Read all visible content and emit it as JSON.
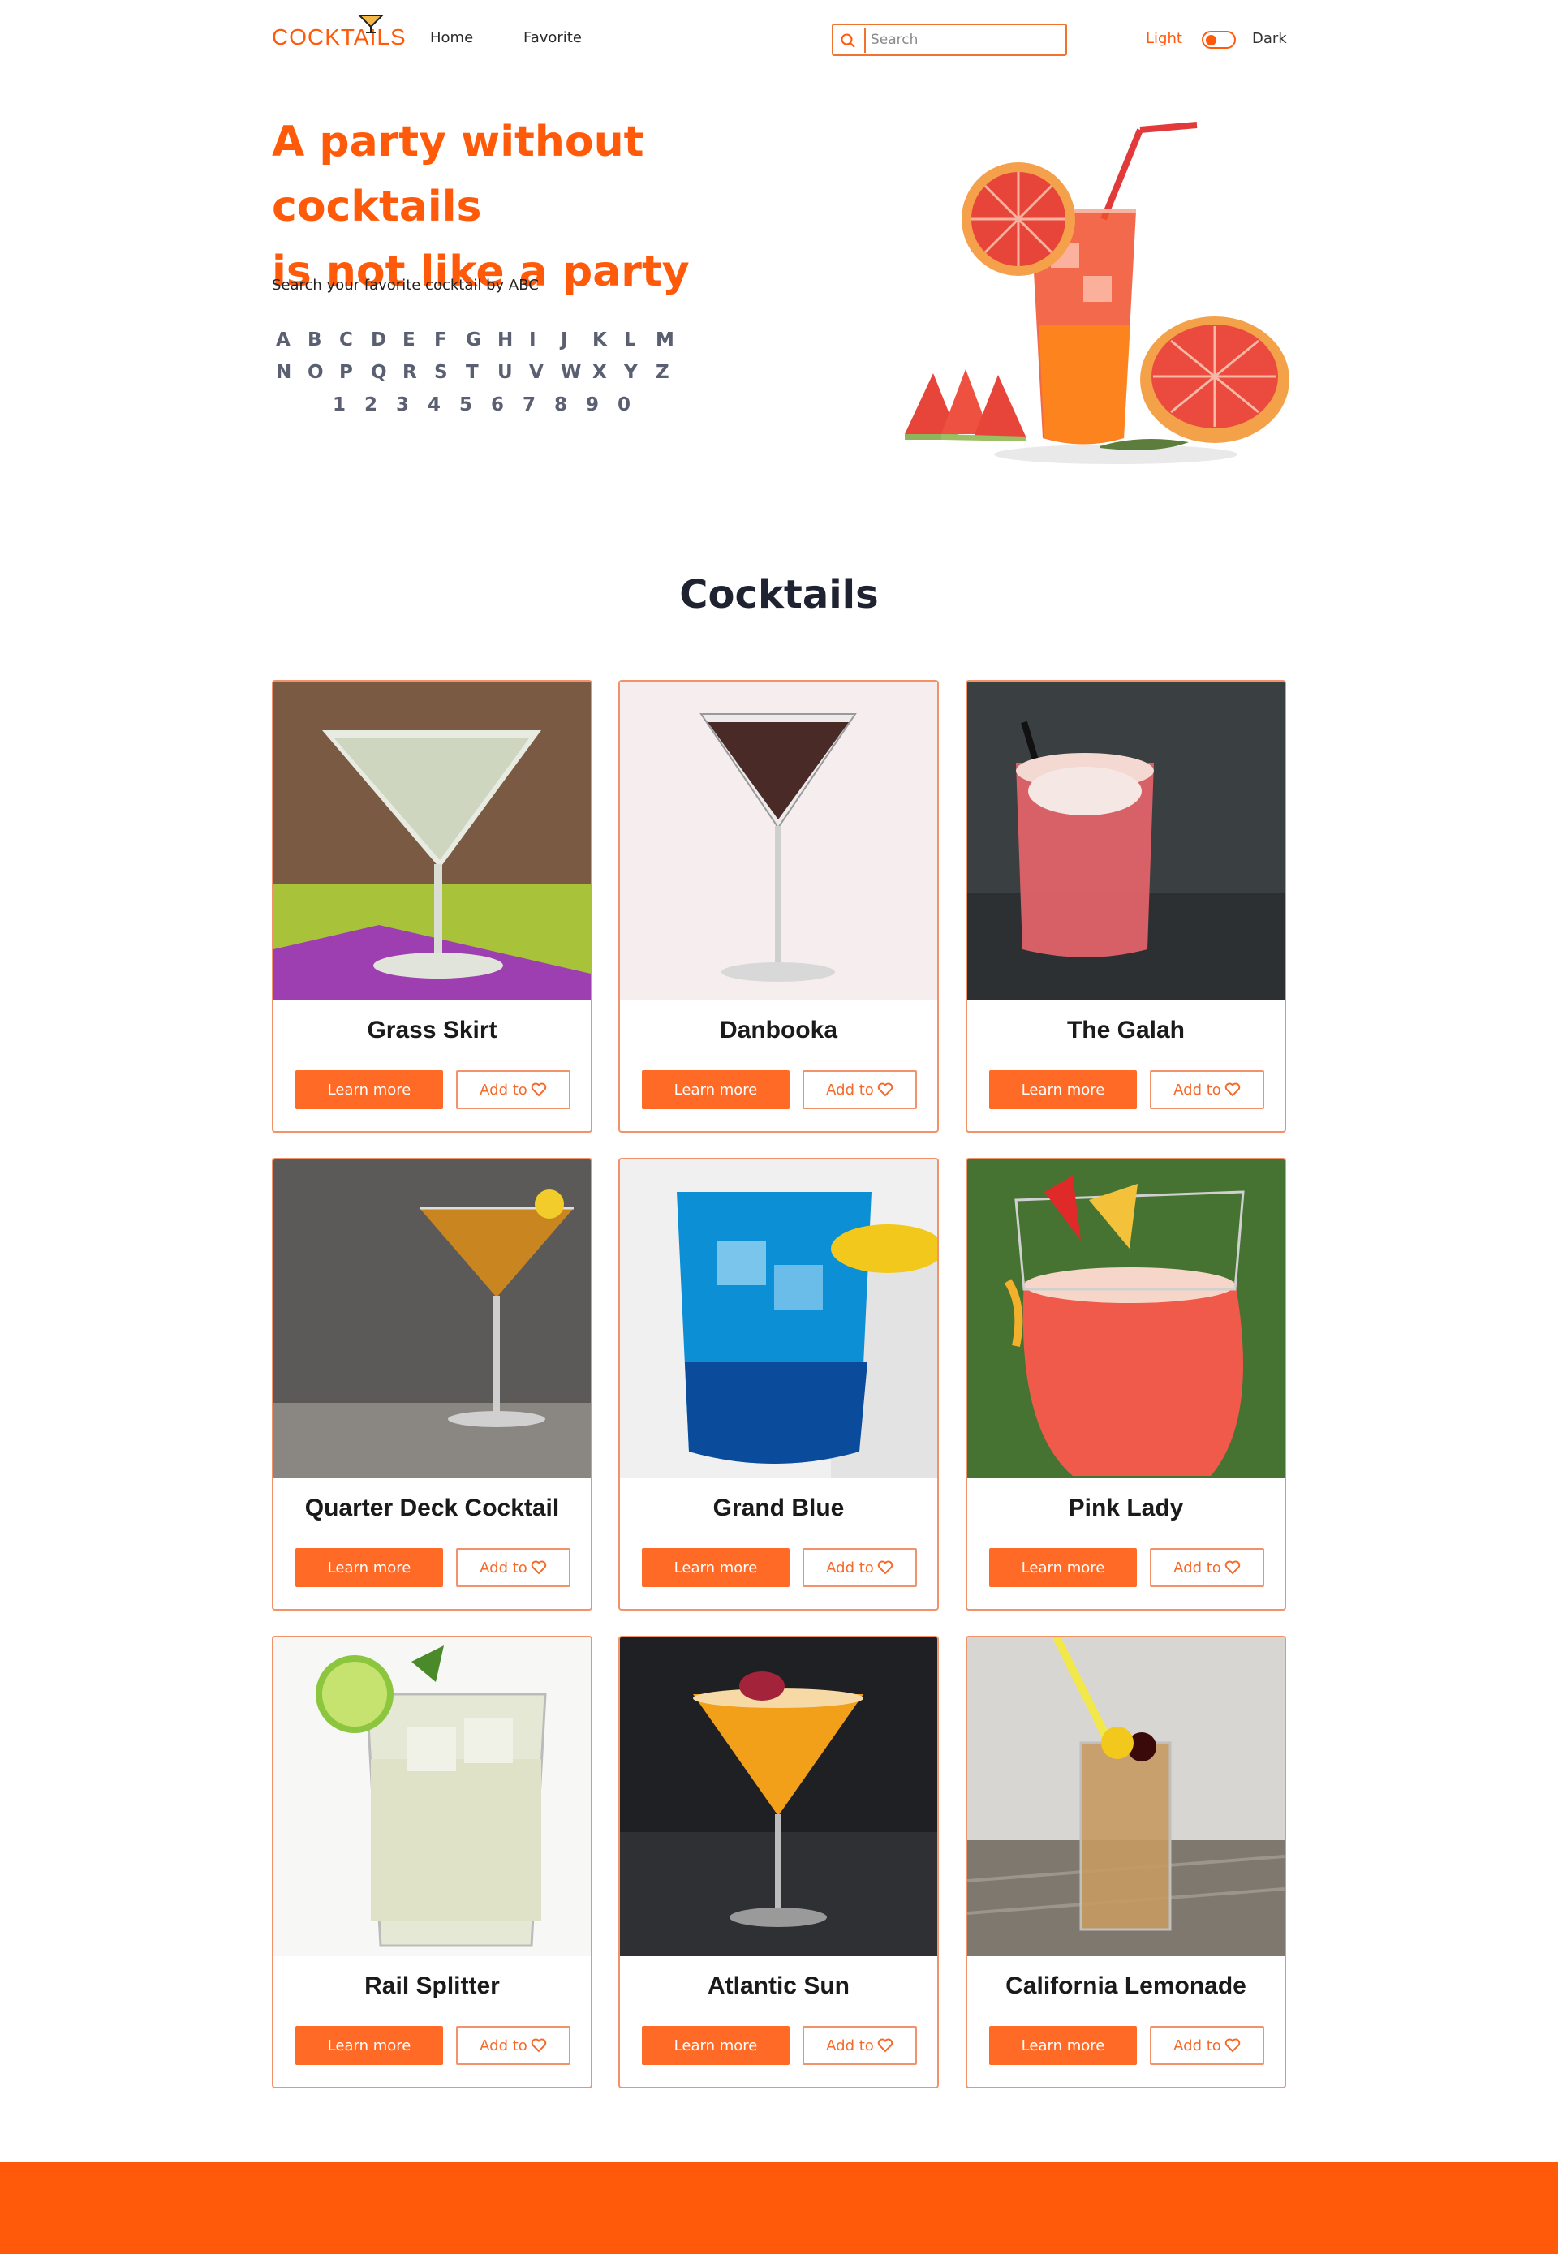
{
  "header": {
    "logo": "COCKTAILS",
    "nav": [
      {
        "label": "Home"
      },
      {
        "label": "Favorite"
      }
    ],
    "search_placeholder": "Search",
    "mode_light": "Light",
    "mode_dark": "Dark"
  },
  "hero": {
    "title_line1": "A party without cocktails",
    "title_line2": "is not like a party",
    "subtitle": "Search your favorite cocktail by ABC",
    "letters_row1": [
      "A",
      "B",
      "C",
      "D",
      "E",
      "F",
      "G",
      "H",
      "I",
      "J",
      "K",
      "L",
      "M"
    ],
    "letters_row2": [
      "N",
      "O",
      "P",
      "Q",
      "R",
      "S",
      "T",
      "U",
      "V",
      "W",
      "X",
      "Y",
      "Z"
    ],
    "numbers": [
      "1",
      "2",
      "3",
      "4",
      "5",
      "6",
      "7",
      "8",
      "9",
      "0"
    ]
  },
  "section_title": "Cocktails",
  "cards": [
    {
      "name": "Grass Skirt",
      "learn": "Learn more",
      "add": "Add to",
      "theme": "martini-clear"
    },
    {
      "name": "Danbooka",
      "learn": "Learn more",
      "add": "Add to",
      "theme": "martini-dark"
    },
    {
      "name": "The Galah",
      "learn": "Learn more",
      "add": "Add to",
      "theme": "rocks-pink"
    },
    {
      "name": "Quarter Deck Cocktail",
      "learn": "Learn more",
      "add": "Add to",
      "theme": "martini-amber"
    },
    {
      "name": "Grand Blue",
      "learn": "Learn more",
      "add": "Add to",
      "theme": "rocks-blue"
    },
    {
      "name": "Pink Lady",
      "learn": "Learn more",
      "add": "Add to",
      "theme": "hurricane-pink"
    },
    {
      "name": "Rail Splitter",
      "learn": "Learn more",
      "add": "Add to",
      "theme": "highball-clear"
    },
    {
      "name": "Atlantic Sun",
      "learn": "Learn more",
      "add": "Add to",
      "theme": "martini-orange"
    },
    {
      "name": "California Lemonade",
      "learn": "Learn more",
      "add": "Add to",
      "theme": "collins-amber"
    }
  ],
  "colors": {
    "accent": "#ff5a0a",
    "button": "#ff6a26",
    "border": "#f2926a"
  }
}
